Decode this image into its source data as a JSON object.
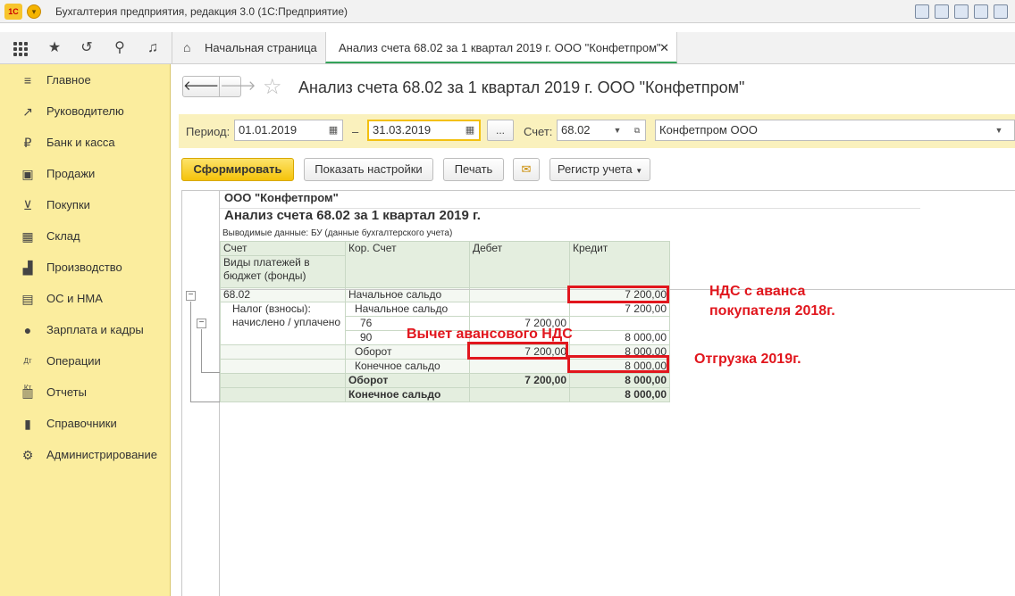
{
  "app": {
    "logo": "1С",
    "title": "Бухгалтерия предприятия, редакция 3.0 (1С:Предприятие)"
  },
  "tabs": [
    {
      "label": "Начальная страница"
    },
    {
      "label": "Анализ счета 68.02 за 1 квартал 2019 г. ООО \"Конфетпром\""
    }
  ],
  "sidebar": {
    "items": [
      {
        "label": "Главное",
        "icon": "menu-lines-icon"
      },
      {
        "label": "Руководителю",
        "icon": "trend-icon"
      },
      {
        "label": "Банк и касса",
        "icon": "ruble-icon"
      },
      {
        "label": "Продажи",
        "icon": "bag-icon"
      },
      {
        "label": "Покупки",
        "icon": "cart-icon"
      },
      {
        "label": "Склад",
        "icon": "warehouse-icon"
      },
      {
        "label": "Производство",
        "icon": "factory-icon"
      },
      {
        "label": "ОС и НМА",
        "icon": "building-icon"
      },
      {
        "label": "Зарплата и кадры",
        "icon": "person-icon"
      },
      {
        "label": "Операции",
        "icon": "dt-kt-icon"
      },
      {
        "label": "Отчеты",
        "icon": "report-icon"
      },
      {
        "label": "Справочники",
        "icon": "book-icon"
      },
      {
        "label": "Администрирование",
        "icon": "gear-icon"
      }
    ]
  },
  "form": {
    "title": "Анализ счета 68.02 за 1 квартал 2019 г. ООО \"Конфетпром\"",
    "period_label": "Период:",
    "date_from": "01.01.2019",
    "dash": "–",
    "date_to": "31.03.2019",
    "ellipsis": "...",
    "account_label": "Счет:",
    "account": "68.02",
    "organization": "Конфетпром ООО",
    "buttons": {
      "generate": "Сформировать",
      "settings": "Показать настройки",
      "print": "Печать",
      "register": "Регистр учета"
    }
  },
  "report": {
    "org": "ООО \"Конфетпром\"",
    "title": "Анализ счета 68.02 за 1 квартал 2019 г.",
    "output": "Выводимые данные:  БУ (данные бухгалтерского учета)",
    "headers": {
      "account": "Счет",
      "payment_types": "Виды платежей в бюджет (фонды)",
      "corr": "Кор. Счет",
      "debit": "Дебет",
      "credit": "Кредит"
    },
    "rows": {
      "r1": {
        "account": "68.02",
        "corr": "Начальное сальдо",
        "debit": "",
        "credit": "7 200,00"
      },
      "r2": {
        "account": "Налог (взносы): начислено / уплачено",
        "corr": "Начальное сальдо",
        "debit": "",
        "credit": "7 200,00"
      },
      "r3": {
        "corr": "76",
        "debit": "7 200,00",
        "credit": ""
      },
      "r4": {
        "corr": "90",
        "debit": "",
        "credit": "8 000,00"
      },
      "r5": {
        "corr": "Оборот",
        "debit": "7 200,00",
        "credit": "8 000,00"
      },
      "r6": {
        "corr": "Конечное сальдо",
        "debit": "",
        "credit": "8 000,00"
      },
      "r7": {
        "corr": "Оборот",
        "debit": "7 200,00",
        "credit": "8 000,00"
      },
      "r8": {
        "corr": "Конечное сальдо",
        "debit": "",
        "credit": "8 000,00"
      }
    }
  },
  "annotations": {
    "vat_advance": "НДС с аванса покупателя 2018г.",
    "deduction": "Вычет авансового НДС",
    "shipment": "Отгрузка 2019г."
  },
  "colors": {
    "sidebar_bg": "#fbed9e",
    "primary_button": "#f5c30a",
    "annotation_red": "#e1161d",
    "report_header": "#e4eedf"
  }
}
